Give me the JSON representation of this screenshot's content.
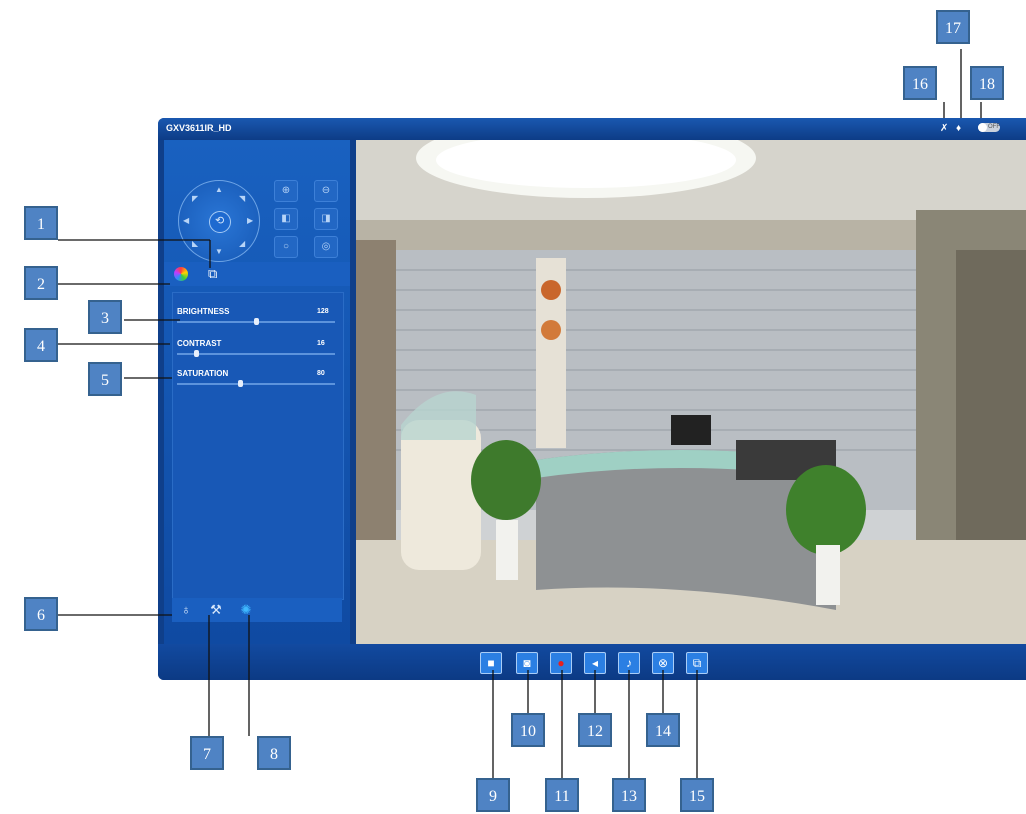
{
  "window": {
    "camera_title": "GXV3611IR_HD"
  },
  "image_settings": [
    {
      "label": "BRIGHTNESS",
      "value": "128",
      "level": 0.5
    },
    {
      "label": "CONTRAST",
      "value": "16",
      "level": 0.12
    },
    {
      "label": "SATURATION",
      "value": "80",
      "level": 0.4
    }
  ],
  "status": {
    "toggle_label": "OFF"
  },
  "callouts": [
    "1",
    "2",
    "3",
    "4",
    "5",
    "6",
    "7",
    "8",
    "9",
    "10",
    "11",
    "12",
    "13",
    "14",
    "15",
    "16",
    "17",
    "18"
  ],
  "colors": {
    "accent": "#0f3f8a",
    "panel": "#1858b6",
    "callout": "#4f83c4"
  }
}
